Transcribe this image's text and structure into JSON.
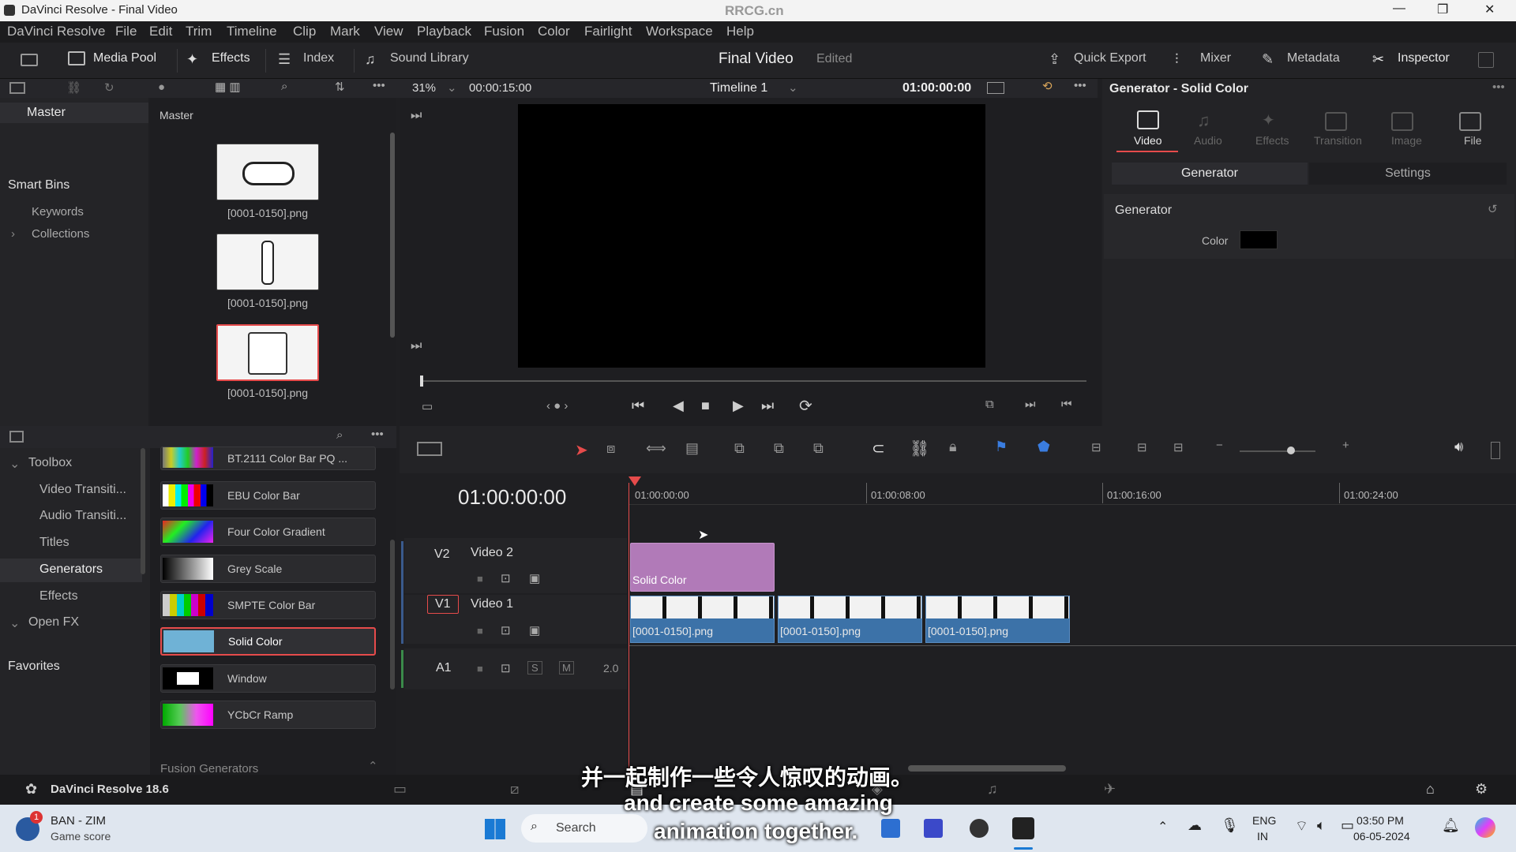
{
  "window": {
    "title": "DaVinci Resolve - Final Video",
    "watermark": "RRCG.cn",
    "minimize": "—",
    "maximize": "❐",
    "close": "✕"
  },
  "menu": [
    "DaVinci Resolve",
    "File",
    "Edit",
    "Trim",
    "Timeline",
    "Clip",
    "Mark",
    "View",
    "Playback",
    "Fusion",
    "Color",
    "Fairlight",
    "Workspace",
    "Help"
  ],
  "toolbar": {
    "media_pool": "Media Pool",
    "effects": "Effects",
    "index": "Index",
    "sound_library": "Sound Library",
    "project_title": "Final Video",
    "project_status": "Edited",
    "quick_export": "Quick Export",
    "mixer": "Mixer",
    "metadata": "Metadata",
    "inspector": "Inspector"
  },
  "viewer": {
    "zoom": "31%",
    "duration": "00:00:15:00",
    "timeline_name": "Timeline 1",
    "timecode": "01:00:00:00"
  },
  "bins": {
    "master": "Master",
    "smart_bins": "Smart Bins",
    "keywords": "Keywords",
    "collections": "Collections"
  },
  "media_pool": {
    "header": "Master",
    "clips": [
      "[0001-0150].png",
      "[0001-0150].png",
      "[0001-0150].png"
    ]
  },
  "effects_tree": {
    "toolbox": "Toolbox",
    "video_transitions": "Video Transiti...",
    "audio_transitions": "Audio Transiti...",
    "titles": "Titles",
    "generators": "Generators",
    "effects": "Effects",
    "open_fx": "Open FX",
    "favorites": "Favorites"
  },
  "generators": [
    "BT.2111 Color Bar PQ ...",
    "EBU Color Bar",
    "Four Color Gradient",
    "Grey Scale",
    "SMPTE Color Bar",
    "Solid Color",
    "Window",
    "YCbCr Ramp"
  ],
  "generators_footer": "Fusion Generators",
  "timeline": {
    "timecode": "01:00:00:00",
    "ruler": [
      "01:00:00:00",
      "01:00:08:00",
      "01:00:16:00",
      "01:00:24:00"
    ],
    "tracks": {
      "v2_id": "V2",
      "v2_name": "Video 2",
      "v1_id": "V1",
      "v1_name": "Video 1",
      "a1_id": "A1",
      "a1_level": "2.0",
      "solo": "S",
      "mute": "M"
    },
    "v2_clip": "Solid Color",
    "v1_clips": [
      "[0001-0150].png",
      "[0001-0150].png",
      "[0001-0150].png"
    ]
  },
  "inspector": {
    "title": "Generator - Solid Color",
    "tabs": [
      "Video",
      "Audio",
      "Effects",
      "Transition",
      "Image",
      "File"
    ],
    "subtabs": [
      "Generator",
      "Settings"
    ],
    "section": "Generator",
    "color_label": "Color",
    "color_value": "#000000"
  },
  "status": {
    "app_version": "DaVinci Resolve 18.6"
  },
  "taskbar": {
    "notif_count": "1",
    "news_title": "BAN - ZIM",
    "news_sub": "Game score",
    "search": "Search",
    "lang1": "ENG",
    "lang2": "IN",
    "time": "03:50 PM",
    "date": "06-05-2024"
  },
  "subtitles": {
    "zh": "并一起制作一些令人惊叹的动画。",
    "en1": "and create some amazing",
    "en2": "animation together."
  },
  "colors": {
    "accent": "#e64b4b",
    "solid_clip": "#b17ab8",
    "video_clip": "#3c72a8",
    "playhead": "#e64b4b"
  }
}
